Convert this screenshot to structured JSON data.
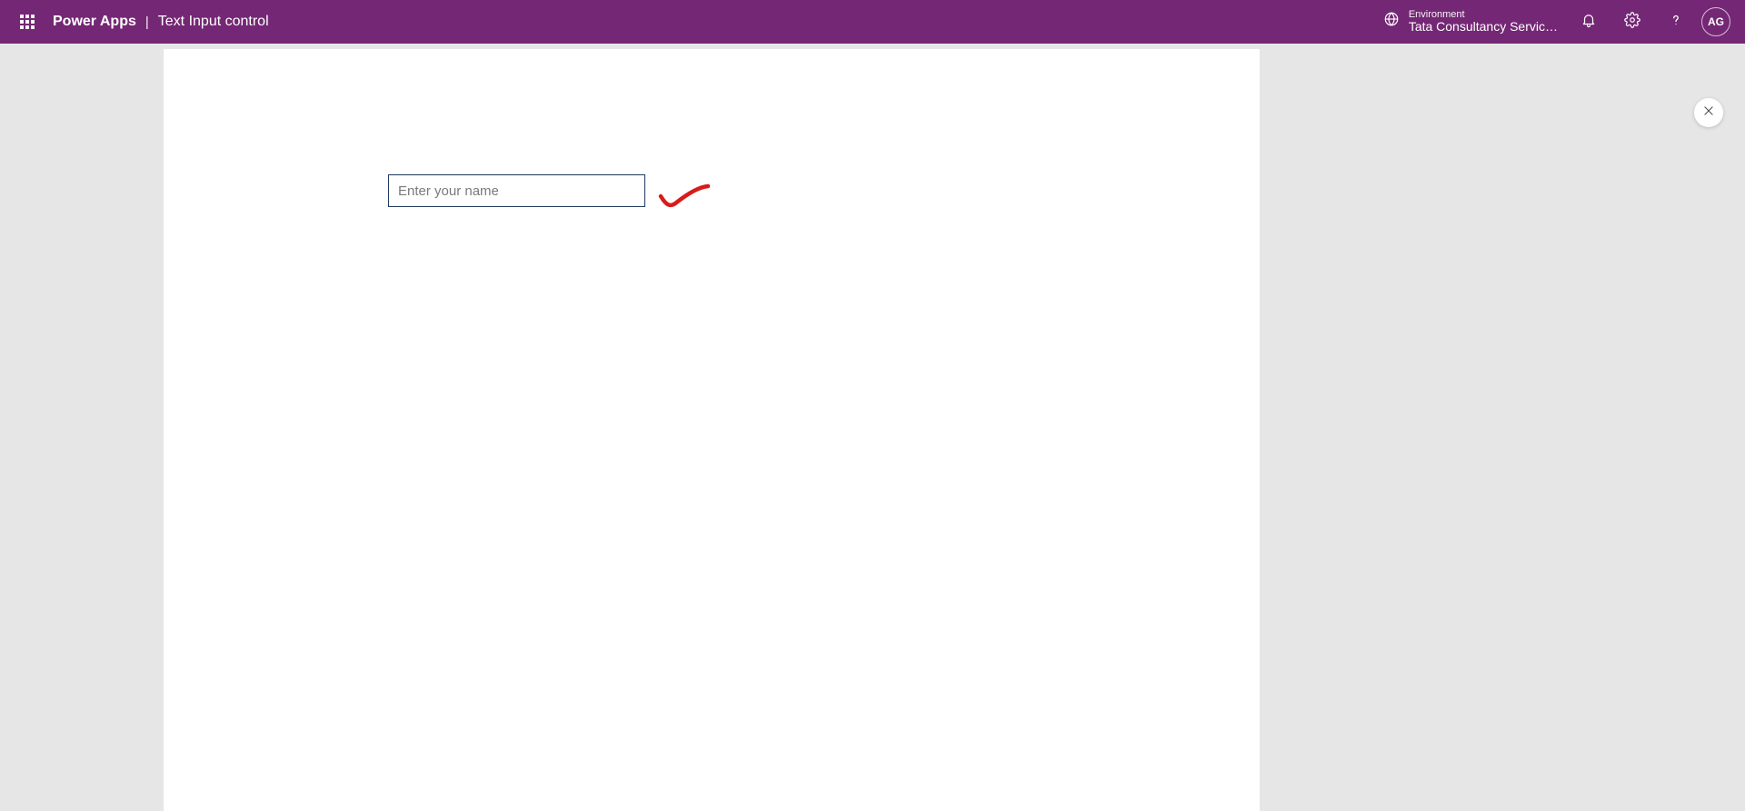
{
  "header": {
    "brand": "Power Apps",
    "page_title": "Text Input control",
    "environment_label": "Environment",
    "environment_name": "Tata Consultancy Servic…",
    "avatar_initials": "AG"
  },
  "canvas": {
    "name_input_placeholder": "Enter your name",
    "name_input_value": ""
  },
  "colors": {
    "header_bg": "#742774",
    "input_border": "#1f3a5f",
    "annotation": "#d81b1b"
  }
}
